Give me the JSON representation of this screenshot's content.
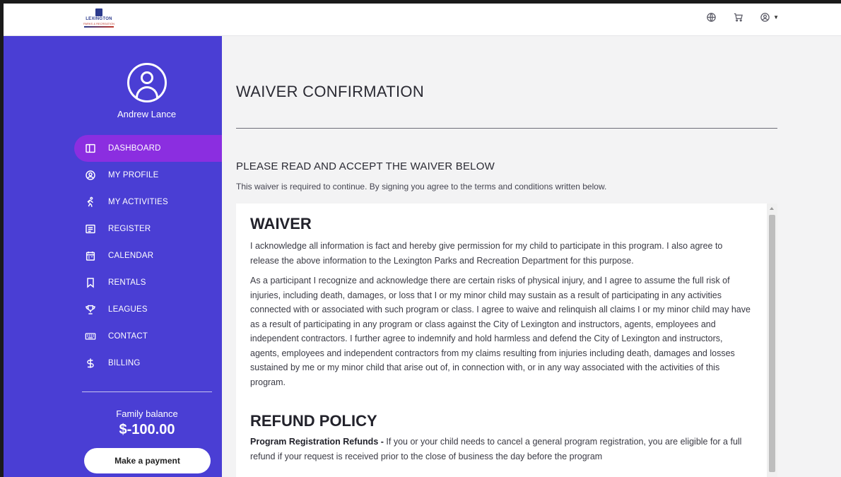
{
  "logo": {
    "word": "LEXINGTON",
    "sub": "PARKS & RECREATION"
  },
  "user": {
    "name": "Andrew Lance"
  },
  "nav": [
    {
      "label": "DASHBOARD",
      "icon": "dashboard-icon",
      "active": true
    },
    {
      "label": "MY PROFILE",
      "icon": "profile-icon"
    },
    {
      "label": "MY ACTIVITIES",
      "icon": "activities-icon"
    },
    {
      "label": "REGISTER",
      "icon": "register-icon"
    },
    {
      "label": "CALENDAR",
      "icon": "calendar-icon"
    },
    {
      "label": "RENTALS",
      "icon": "bookmark-icon"
    },
    {
      "label": "LEAGUES",
      "icon": "trophy-icon"
    },
    {
      "label": "CONTACT",
      "icon": "keyboard-icon"
    },
    {
      "label": "BILLING",
      "icon": "dollar-icon"
    }
  ],
  "balance": {
    "label": "Family balance",
    "value": "$-100.00",
    "pay_label": "Make a payment"
  },
  "page": {
    "title": "WAIVER CONFIRMATION",
    "heading": "PLEASE READ AND ACCEPT THE WAIVER BELOW",
    "subtext": "This waiver is required to continue. By signing you agree to the terms and conditions written below."
  },
  "waiver": {
    "title": "WAIVER",
    "p1": "I acknowledge all information is fact and hereby give permission for my child to participate in this program. I also agree to release the above information to the Lexington Parks and Recreation Department for this purpose.",
    "p2": "As a participant I recognize and acknowledge there are certain risks of physical injury, and I agree to assume the full risk of injuries, including death, damages, or loss that I or my minor child may sustain as a result of participating in any activities connected with or associated with such program or class. I agree to waive and relinquish all claims I or my minor child may have as a result of participating in any program or class against the City of Lexington and instructors, agents, employees and independent contractors. I further agree to indemnify and hold harmless and defend the City of Lexington and instructors, agents, employees and independent contractors from my claims resulting from injuries including death, damages and losses sustained by me or my minor child that arise out of, in connection with, or in any way associated with the activities of this program.",
    "refund_title": "REFUND POLICY",
    "refund_lead": "Program Registration Refunds -",
    "refund_text": " If you or your child needs to cancel a general program registration, you are eligible for a full refund if your request is received prior to the close of business the day before the program"
  },
  "colors": {
    "sidebar": "#4a3ed4",
    "active": "#8b2ee0"
  }
}
